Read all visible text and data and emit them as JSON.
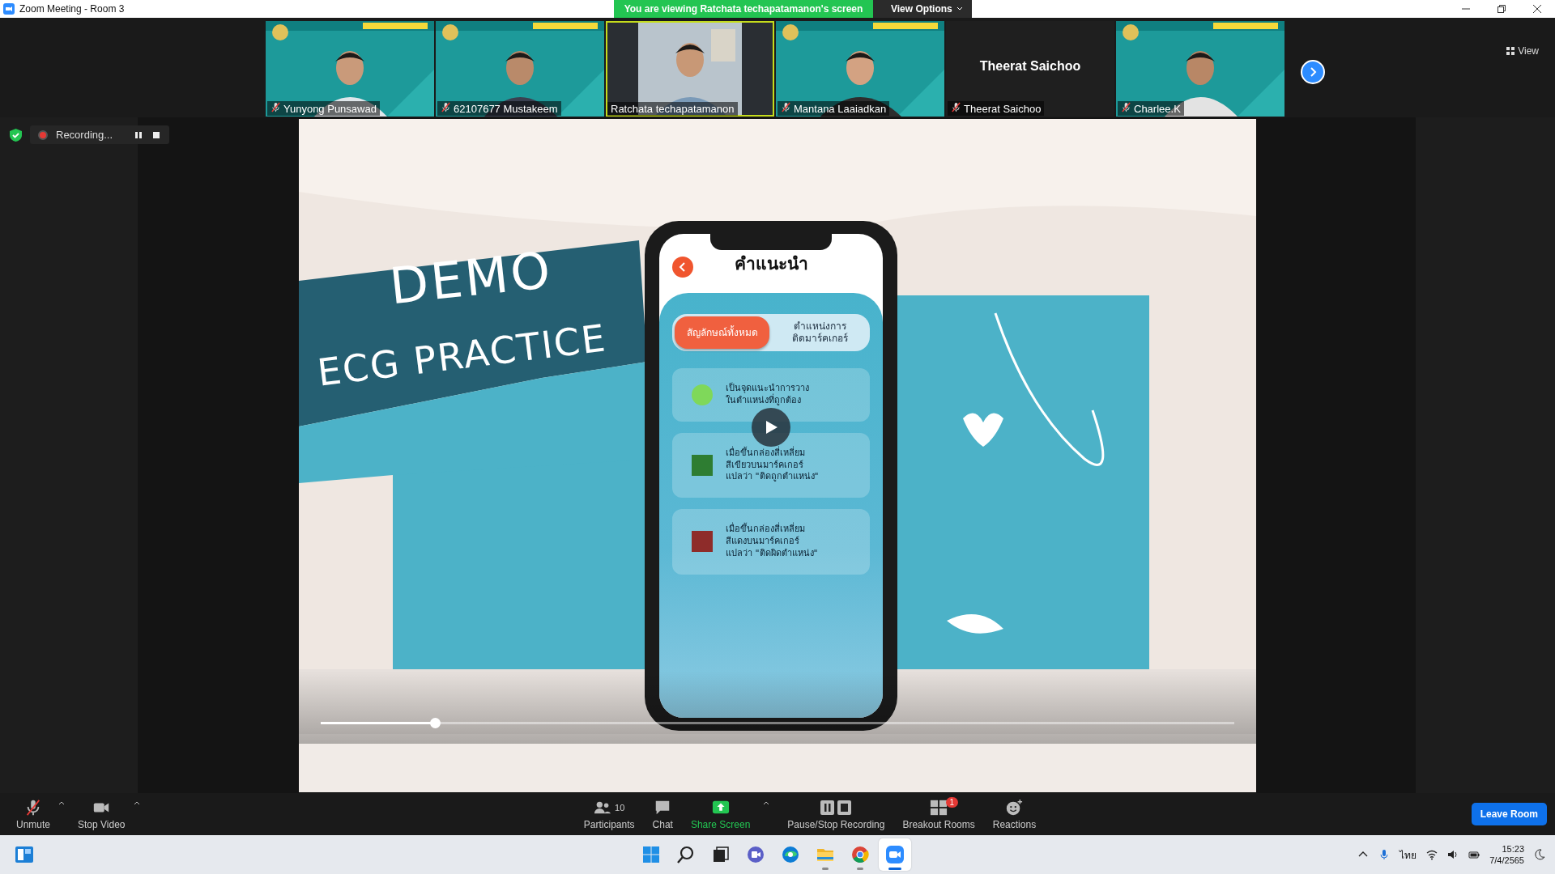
{
  "window": {
    "title": "Zoom Meeting - Room 3"
  },
  "share_banner": {
    "text": "You are viewing Ratchata techapatamanon's screen",
    "options": "View Options"
  },
  "view_button": "View",
  "participants": [
    {
      "name": "Yunyong Punsawad",
      "kind": "video",
      "muted": true,
      "speaking": false
    },
    {
      "name": "62107677 Mustakeem",
      "kind": "video",
      "muted": true,
      "speaking": false
    },
    {
      "name": "Ratchata techapatamanon",
      "kind": "video",
      "muted": false,
      "speaking": true
    },
    {
      "name": "Mantana Laaiadkan",
      "kind": "video",
      "muted": true,
      "speaking": false
    },
    {
      "name": "Theerat Saichoo",
      "kind": "no_video",
      "display_name": "Theerat Saichoo",
      "muted": true,
      "speaking": false
    },
    {
      "name": "Charlee.K",
      "kind": "video",
      "muted": true,
      "speaking": false
    }
  ],
  "recording": {
    "label": "Recording..."
  },
  "shared_screen": {
    "slide_title": "DEMO",
    "slide_subtitle": "ECG PRACTICE",
    "app": {
      "title": "คำแนะนำ",
      "tabs": [
        {
          "label": "สัญลักษณ์ทั้งหมด",
          "selected": true
        },
        {
          "label": "ตำแหน่งการ\nติดมาร์คเกอร์",
          "selected": false
        }
      ],
      "legend": [
        {
          "kind": "circle",
          "color": "#7fd85a",
          "text": "เป็นจุดแนะนำการวาง\nในตำแหน่งที่ถูกต้อง"
        },
        {
          "kind": "square",
          "color": "#2e7d32",
          "text": "เมื่อขึ้นกล่องสี่เหลี่ยม\nสีเขียวบนมาร์คเกอร์\nแปลว่า \"ติดถูกตำแหน่ง\""
        },
        {
          "kind": "square",
          "color": "#8e2c2a",
          "text": "เมื่อขึ้นกล่องสี่เหลี่ยม\nสีแดงบนมาร์คเกอร์\nแปลว่า \"ติดผิดตำแหน่ง\""
        }
      ]
    },
    "player": {
      "level": 0.125
    }
  },
  "toolbar": {
    "left": [
      {
        "kind": "mic",
        "label": "Unmute",
        "muted": true
      },
      {
        "kind": "video",
        "label": "Stop Video",
        "muted": false
      }
    ],
    "center": [
      {
        "kind": "participants",
        "label": "Participants",
        "count": "10"
      },
      {
        "kind": "chat",
        "label": "Chat"
      },
      {
        "kind": "share",
        "label": "Share Screen"
      },
      {
        "kind": "recording",
        "label": "Pause/Stop Recording"
      },
      {
        "kind": "breakout",
        "label": "Breakout Rooms",
        "badge": "1"
      },
      {
        "kind": "reactions",
        "label": "Reactions"
      }
    ],
    "leave": "Leave Room"
  },
  "taskbar": {
    "apps": [
      {
        "kind": "start",
        "running": false,
        "selected": false
      },
      {
        "kind": "search",
        "running": false,
        "selected": false
      },
      {
        "kind": "taskview",
        "running": false,
        "selected": false
      },
      {
        "kind": "teams",
        "running": false,
        "selected": false
      },
      {
        "kind": "edge",
        "running": false,
        "selected": false
      },
      {
        "kind": "explorer",
        "running": true,
        "selected": false
      },
      {
        "kind": "chrome",
        "running": true,
        "selected": false
      },
      {
        "kind": "zoom",
        "running": true,
        "selected": true
      }
    ],
    "language": "ไทย",
    "time": "15:23",
    "date": "7/4/2565"
  }
}
